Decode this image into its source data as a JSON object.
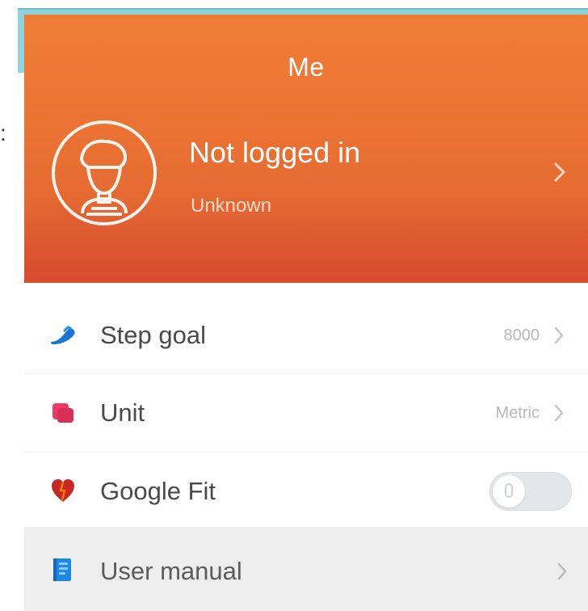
{
  "page": {
    "title": "Me"
  },
  "profile": {
    "name": "Not logged in",
    "subtitle": "Unknown"
  },
  "background": {
    "edge_text": ":"
  },
  "menu": {
    "items": [
      {
        "label": "Step goal",
        "value": "8000",
        "icon": "shoe-icon"
      },
      {
        "label": "Unit",
        "value": "Metric",
        "icon": "unit-icon"
      },
      {
        "label": "Google Fit",
        "value": "",
        "icon": "heart-icon",
        "toggle": "off"
      },
      {
        "label": "User manual",
        "value": "",
        "icon": "manual-icon"
      }
    ]
  },
  "colors": {
    "header_top": "#ee7d37",
    "header_bottom": "#dc5532",
    "background_accent": "#8ed3dd",
    "row_highlight": "#eeeeee"
  }
}
